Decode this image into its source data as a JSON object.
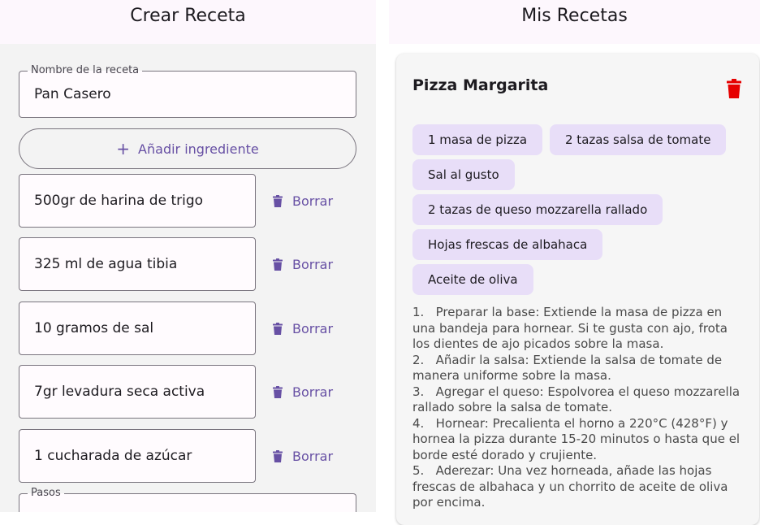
{
  "left_panel": {
    "title": "Crear Receta",
    "recipe_name": {
      "label": "Nombre de la receta",
      "value": "Pan Casero"
    },
    "add_ingredient_label": "Añadir ingrediente",
    "ingredients": [
      {
        "value": "500gr de harina de trigo",
        "delete_label": "Borrar"
      },
      {
        "value": "325 ml de agua tibia",
        "delete_label": "Borrar"
      },
      {
        "value": "10 gramos de sal",
        "delete_label": "Borrar"
      },
      {
        "value": "7gr levadura seca activa",
        "delete_label": "Borrar"
      },
      {
        "value": "1 cucharada de azúcar",
        "delete_label": "Borrar"
      }
    ],
    "steps_field": {
      "label": "Pasos"
    }
  },
  "right_panel": {
    "title": "Mis Recetas",
    "recipe_card": {
      "title": "Pizza Margarita",
      "ingredients": [
        "1 masa de pizza",
        "2 tazas salsa de tomate",
        "Sal al gusto",
        "2 tazas de queso mozzarella rallado",
        "Hojas frescas de albahaca",
        "Aceite de oliva"
      ],
      "steps": [
        "1.   Preparar la base: Extiende la masa de pizza en una bandeja para hornear. Si te gusta con ajo, frota los dientes de ajo picados sobre la masa.",
        "2.   Añadir la salsa: Extiende la salsa de tomate de manera uniforme sobre la masa.",
        "3.   Agregar el queso: Espolvorea el queso mozzarella rallado sobre la salsa de tomate.",
        "4.   Hornear: Precalienta el horno a 220°C (428°F) y hornea la pizza durante 15-20 minutos o hasta que el borde esté dorado y crujiente.",
        "5.   Aderezar: Una vez horneada, añade las hojas frescas de albahaca y un chorrito de aceite de oliva por encima."
      ]
    }
  },
  "icons": {
    "add": "plus-icon",
    "delete": "trash-icon",
    "delete_recipe": "trash-icon"
  },
  "colors": {
    "primary": "#6750a4",
    "chip_background": "#e8def8",
    "delete_recipe": "#e60000",
    "panel_background": "#f3f3f3",
    "header_background": "#fdf7fd"
  }
}
